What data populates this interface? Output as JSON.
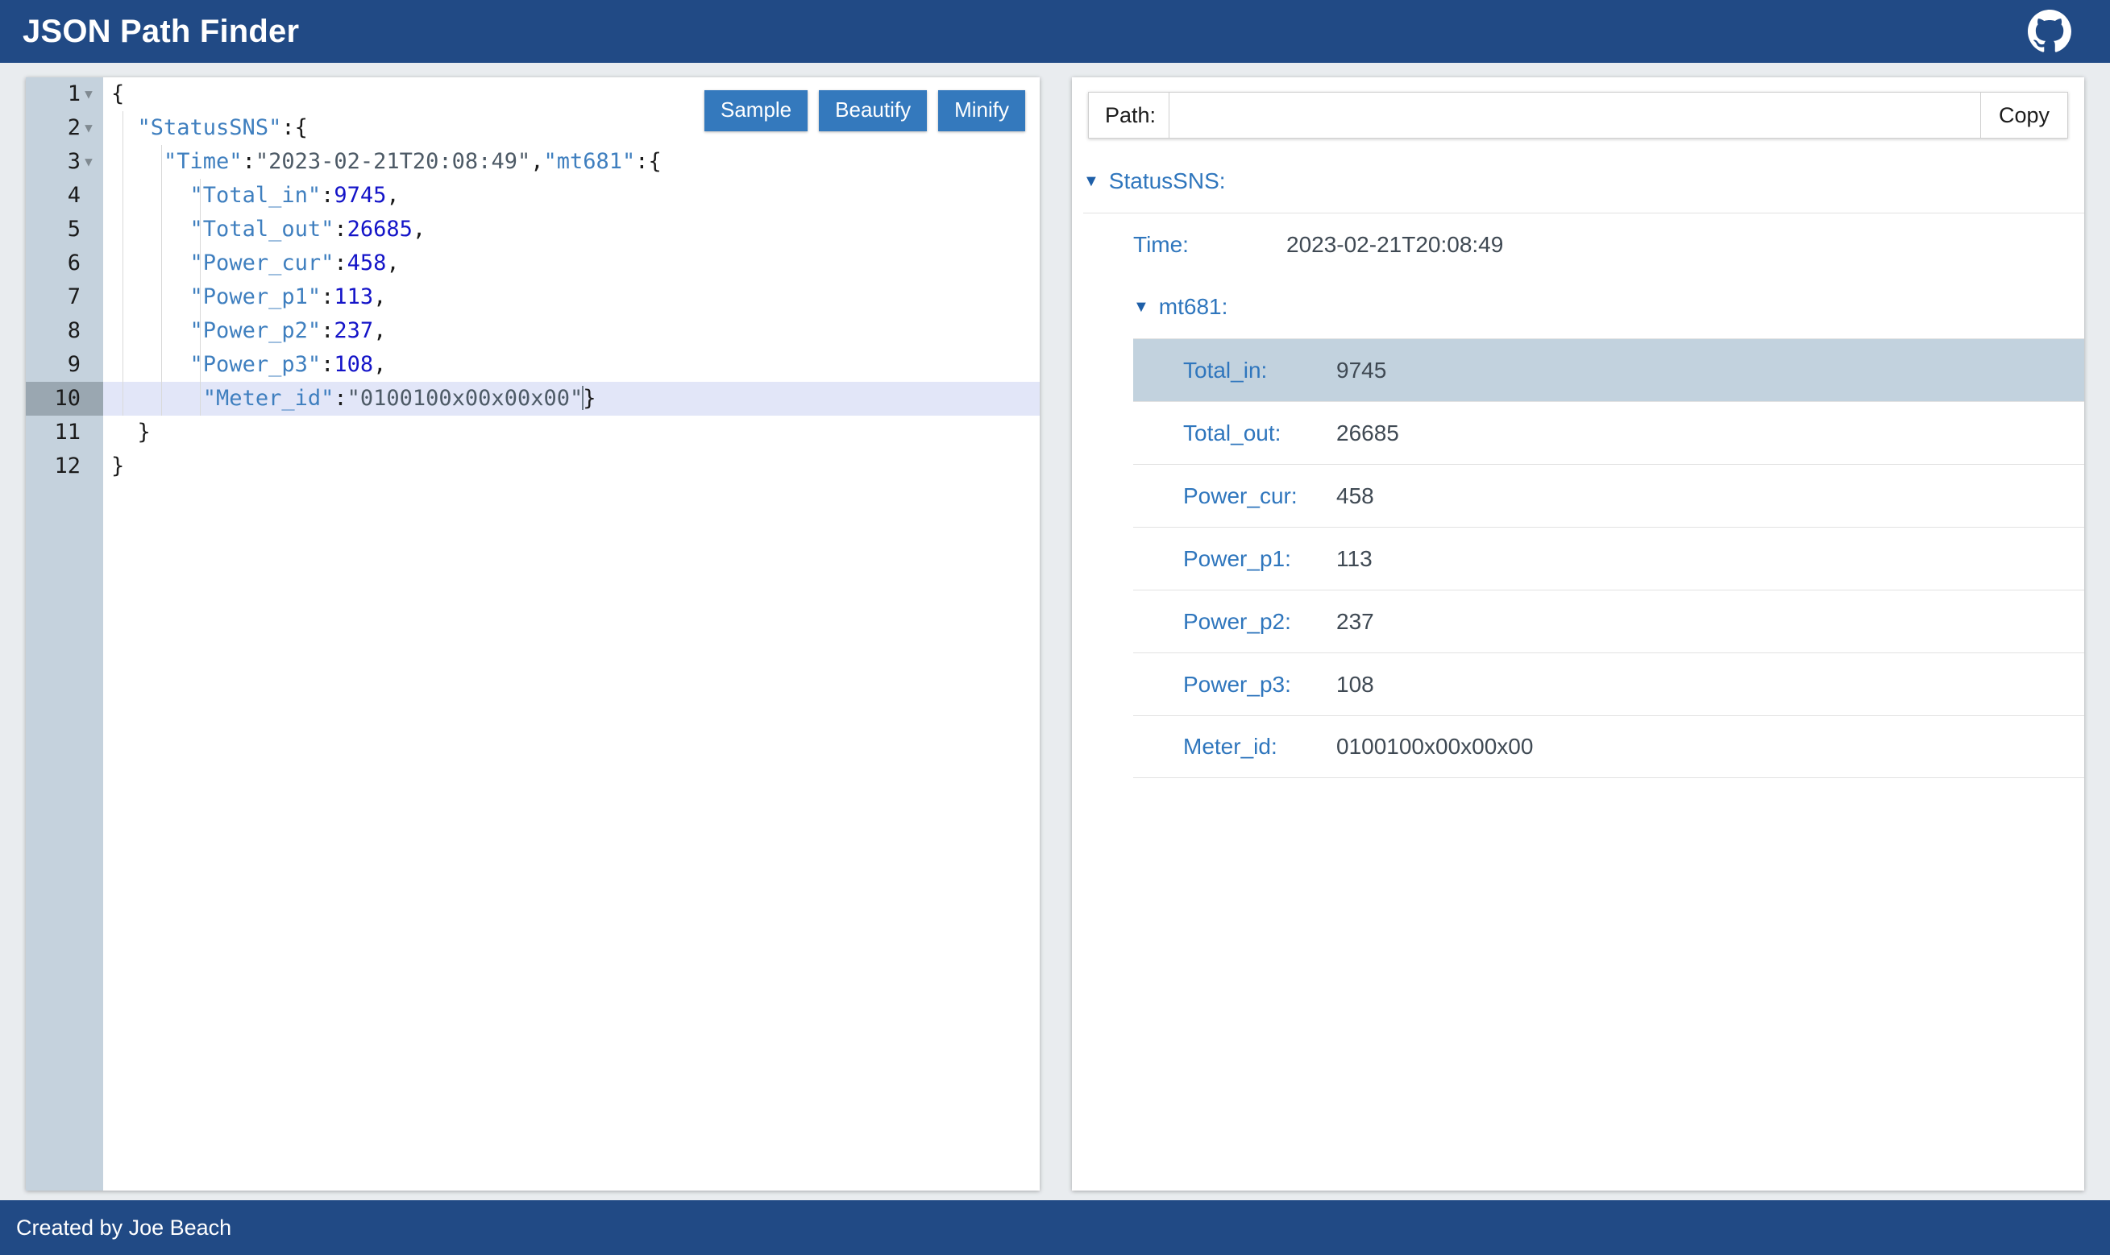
{
  "header": {
    "title": "JSON Path Finder",
    "github_icon": "github-icon",
    "accent_color": "#214a85"
  },
  "editor": {
    "buttons": [
      {
        "label": "Sample",
        "name": "sample-button"
      },
      {
        "label": "Beautify",
        "name": "beautify-button"
      },
      {
        "label": "Minify",
        "name": "minify-button"
      }
    ],
    "button_color": "#3479bd",
    "active_line": 10,
    "line_numbers": [
      "1",
      "2",
      "3",
      "4",
      "5",
      "6",
      "7",
      "8",
      "9",
      "10",
      "11",
      "12"
    ],
    "fold_arrows": [
      true,
      true,
      true,
      false,
      false,
      false,
      false,
      false,
      false,
      false,
      false,
      false
    ],
    "lines": [
      {
        "n": "1",
        "indent": 0,
        "key": "",
        "value": "",
        "type": "open",
        "text": "{"
      },
      {
        "n": "2",
        "indent": 1,
        "key": "\"StatusSNS\"",
        "value": "",
        "type": "objkey",
        "text": "\"StatusSNS\":{"
      },
      {
        "n": "3",
        "indent": 2,
        "key": "\"Time\"",
        "value": "\"2023-02-21T20:08:49\"",
        "type": "timeline",
        "text": "\"Time\":\"2023-02-21T20:08:49\",\"mt681\":{"
      },
      {
        "n": "4",
        "indent": 3,
        "key": "\"Total_in\"",
        "value": "9745",
        "type": "num",
        "text": "\"Total_in\":9745,"
      },
      {
        "n": "5",
        "indent": 3,
        "key": "\"Total_out\"",
        "value": "26685",
        "type": "num",
        "text": "\"Total_out\":26685,"
      },
      {
        "n": "6",
        "indent": 3,
        "key": "\"Power_cur\"",
        "value": "458",
        "type": "num",
        "text": "\"Power_cur\":458,"
      },
      {
        "n": "7",
        "indent": 3,
        "key": "\"Power_p1\"",
        "value": "113",
        "type": "num",
        "text": "\"Power_p1\":113,"
      },
      {
        "n": "8",
        "indent": 3,
        "key": "\"Power_p2\"",
        "value": "237",
        "type": "num",
        "text": "\"Power_p2\":237,"
      },
      {
        "n": "9",
        "indent": 3,
        "key": "\"Power_p3\"",
        "value": "108",
        "type": "num",
        "text": "\"Power_p3\":108,"
      },
      {
        "n": "10",
        "indent": 3,
        "key": "\"Meter_id\"",
        "value": "\"0100100x00x00x00\"",
        "type": "strclose",
        "text": "\"Meter_id\":\"0100100x00x00x00\"}"
      },
      {
        "n": "11",
        "indent": 1,
        "key": "",
        "value": "",
        "type": "close",
        "text": "}"
      },
      {
        "n": "12",
        "indent": 0,
        "key": "",
        "value": "",
        "type": "close",
        "text": "}"
      }
    ],
    "tokens": {
      "l1_brace": "{",
      "l2_key": "\"StatusSNS\"",
      "l2_colon": ":",
      "l2_brace": "{",
      "l3_key": "\"Time\"",
      "l3_colon": ":",
      "l3_str": "\"2023-02-21T20:08:49\"",
      "l3_comma": ",",
      "l3_key2": "\"mt681\"",
      "l3_colon2": ":",
      "l3_brace": "{",
      "l4_key": "\"Total_in\"",
      "l4_colon": ":",
      "l4_num": "9745",
      "l4_comma": ",",
      "l5_key": "\"Total_out\"",
      "l5_colon": ":",
      "l5_num": "26685",
      "l5_comma": ",",
      "l6_key": "\"Power_cur\"",
      "l6_colon": ":",
      "l6_num": "458",
      "l6_comma": ",",
      "l7_key": "\"Power_p1\"",
      "l7_colon": ":",
      "l7_num": "113",
      "l7_comma": ",",
      "l8_key": "\"Power_p2\"",
      "l8_colon": ":",
      "l8_num": "237",
      "l8_comma": ",",
      "l9_key": "\"Power_p3\"",
      "l9_colon": ":",
      "l9_num": "108",
      "l9_comma": ",",
      "l10_key": "\"Meter_id\"",
      "l10_colon": ":",
      "l10_str": "\"0100100x00x00x00\"",
      "l10_brace": "}",
      "l11_brace": "}",
      "l12_brace": "}"
    }
  },
  "viewer": {
    "path_label": "Path:",
    "path_value": "",
    "path_placeholder": "",
    "copy_label": "Copy",
    "tree": {
      "root_label": "StatusSNS:",
      "root_twisty": "▼",
      "time_label": "Time:",
      "time_value": "2023-02-21T20:08:49",
      "mt681_label": "mt681:",
      "mt681_twisty": "▼",
      "leaves": [
        {
          "label": "Total_in:",
          "value": "9745",
          "selected": true
        },
        {
          "label": "Total_out:",
          "value": "26685",
          "selected": false
        },
        {
          "label": "Power_cur:",
          "value": "458",
          "selected": false
        },
        {
          "label": "Power_p1:",
          "value": "113",
          "selected": false
        },
        {
          "label": "Power_p2:",
          "value": "237",
          "selected": false
        },
        {
          "label": "Power_p3:",
          "value": "108",
          "selected": false
        },
        {
          "label": "Meter_id:",
          "value": "0100100x00x00x00",
          "selected": false
        }
      ],
      "selected_highlight_color": "#c2d2de"
    }
  },
  "footer": {
    "text": "Created by Joe Beach"
  }
}
